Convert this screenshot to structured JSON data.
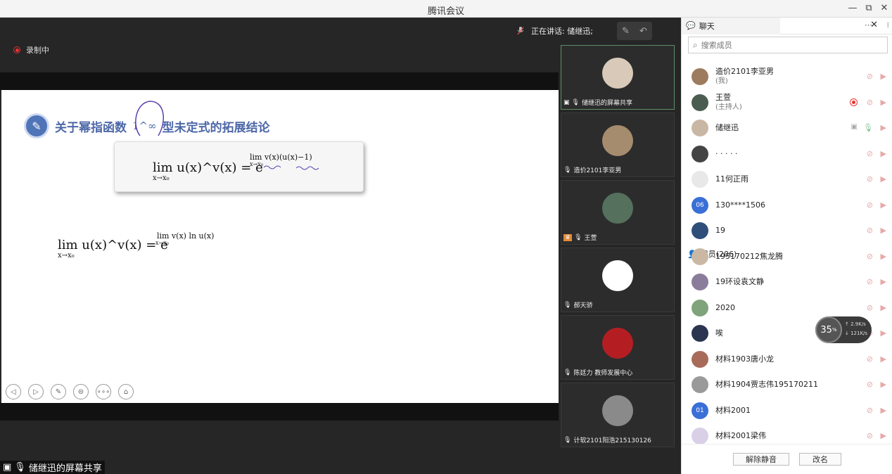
{
  "window": {
    "title": "腾讯会议",
    "controls": [
      "—",
      "⧉",
      "✕"
    ]
  },
  "meeting": {
    "recording_label": "录制中",
    "speaking_label": "正在讲话: 储继迅;"
  },
  "slide": {
    "heading_prefix": "关于幂指函数",
    "heading_symbol": "1^∞",
    "heading_suffix": "型未定式的拓展结论",
    "formula1_lhs": "lim u(x)^v(x) = e",
    "formula1_sub": "x→x₀",
    "formula1_exp": "lim v(x)(u(x)−1)",
    "formula1_exp_sub": "x→x₀",
    "formula2_lhs": "lim u(x)^v(x) = e",
    "formula2_sub": "x→x₀",
    "formula2_exp": "lim v(x) ln u(x)",
    "formula2_exp_sub": "x→x₀",
    "controls": [
      "◁",
      "▷",
      "✎",
      "⊜",
      "∘∘∘",
      "⌂"
    ]
  },
  "screen_share_label": "储继迅的屏幕共享",
  "tiles": [
    {
      "label": "储继迅的屏幕共享",
      "color": "#d9c9b8",
      "active": true
    },
    {
      "label": "造价2101李亚男",
      "color": "#a68c6e",
      "active": false
    },
    {
      "label": "王萱",
      "color": "#55705d",
      "active": false
    },
    {
      "label": "郝天骄",
      "color": "#ffffff",
      "active": false
    },
    {
      "label": "陈廷力 教师发展中心",
      "color": "#b41e22",
      "active": false
    },
    {
      "label": "计软2101阳浩215130126",
      "color": "#8a8a8a",
      "active": false
    }
  ],
  "panel": {
    "tab_chat": "聊天",
    "tab_members": "成员(206)",
    "more": "⋯",
    "close": "✕",
    "search_placeholder": "搜索成员",
    "members": [
      {
        "name": "造价2101李亚男",
        "sub": "(我)",
        "color": "#9c7b5e",
        "initial": ""
      },
      {
        "name": "王萱",
        "sub": "(主持人)",
        "color": "#4b5d50",
        "initial": "",
        "recording": true
      },
      {
        "name": "储继迅",
        "sub": "",
        "color": "#c9b7a4",
        "initial": "",
        "speaking": true
      },
      {
        "name": "· · · · ·",
        "sub": "",
        "color": "#444444",
        "initial": ""
      },
      {
        "name": "11何正雨",
        "sub": "",
        "color": "#e8e8e8",
        "initial": ""
      },
      {
        "name": "130****1506",
        "sub": "",
        "color": "#3a6fd8",
        "initial": "06"
      },
      {
        "name": "19",
        "sub": "",
        "color": "#2f4f7a",
        "initial": ""
      },
      {
        "name": "195170212焦龙腾",
        "sub": "",
        "color": "#cbb8a4",
        "initial": ""
      },
      {
        "name": "19环设袁文静",
        "sub": "",
        "color": "#8a7d9c",
        "initial": ""
      },
      {
        "name": "2020",
        "sub": "",
        "color": "#7fa37a",
        "initial": ""
      },
      {
        "name": "唉",
        "sub": "",
        "color": "#2b3550",
        "initial": ""
      },
      {
        "name": "材料1903唐小龙",
        "sub": "",
        "color": "#a86b5a",
        "initial": ""
      },
      {
        "name": "材料1904贾志伟195170211",
        "sub": "",
        "color": "#9a9a9a",
        "initial": ""
      },
      {
        "name": "材料2001",
        "sub": "",
        "color": "#3a6fd8",
        "initial": "01"
      },
      {
        "name": "材料2001梁伟",
        "sub": "",
        "color": "#d9d0e8",
        "initial": ""
      }
    ],
    "btn_unmute": "解除静音",
    "btn_rename": "改名"
  },
  "network": {
    "percent": "35",
    "percent_unit": "%",
    "up": "2.9",
    "up_unit": "K/s",
    "down": "121",
    "down_unit": "K/s"
  }
}
